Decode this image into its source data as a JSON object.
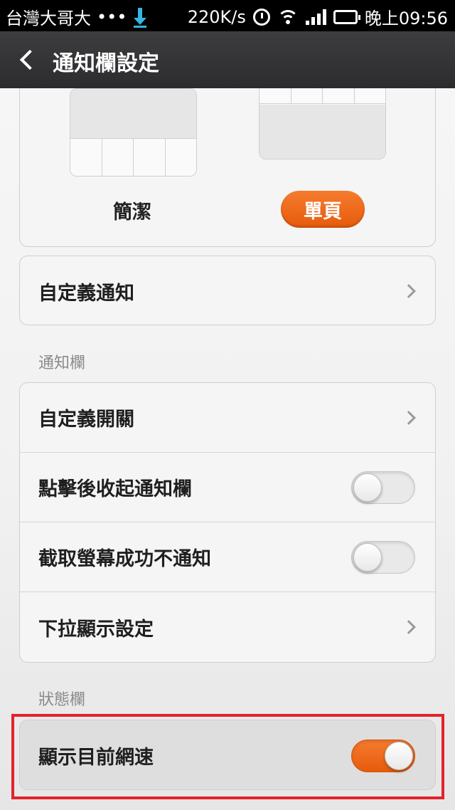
{
  "status_bar": {
    "carrier": "台灣大哥大",
    "dots": "•••",
    "speed": "220K/s",
    "time": "晚上09:56",
    "icons": [
      "download-icon",
      "alarm-icon",
      "wifi-icon",
      "signal-icon",
      "battery-icon"
    ]
  },
  "titlebar": {
    "title": "通知欄設定"
  },
  "style_picker": {
    "option_a": "簡潔",
    "option_b": "單頁",
    "selected": "單頁"
  },
  "custom_notification": {
    "label": "自定義通知"
  },
  "notification_section": {
    "header": "通知欄",
    "items": [
      {
        "label": "自定義開關",
        "type": "link"
      },
      {
        "label": "點擊後收起通知欄",
        "type": "toggle",
        "value": false
      },
      {
        "label": "截取螢幕成功不通知",
        "type": "toggle",
        "value": false
      },
      {
        "label": "下拉顯示設定",
        "type": "link"
      }
    ]
  },
  "status_section": {
    "header": "狀態欄",
    "items": [
      {
        "label": "顯示目前網速",
        "type": "toggle",
        "value": true
      }
    ]
  },
  "colors": {
    "accent": "#e8600f",
    "highlight": "#e3232c"
  }
}
